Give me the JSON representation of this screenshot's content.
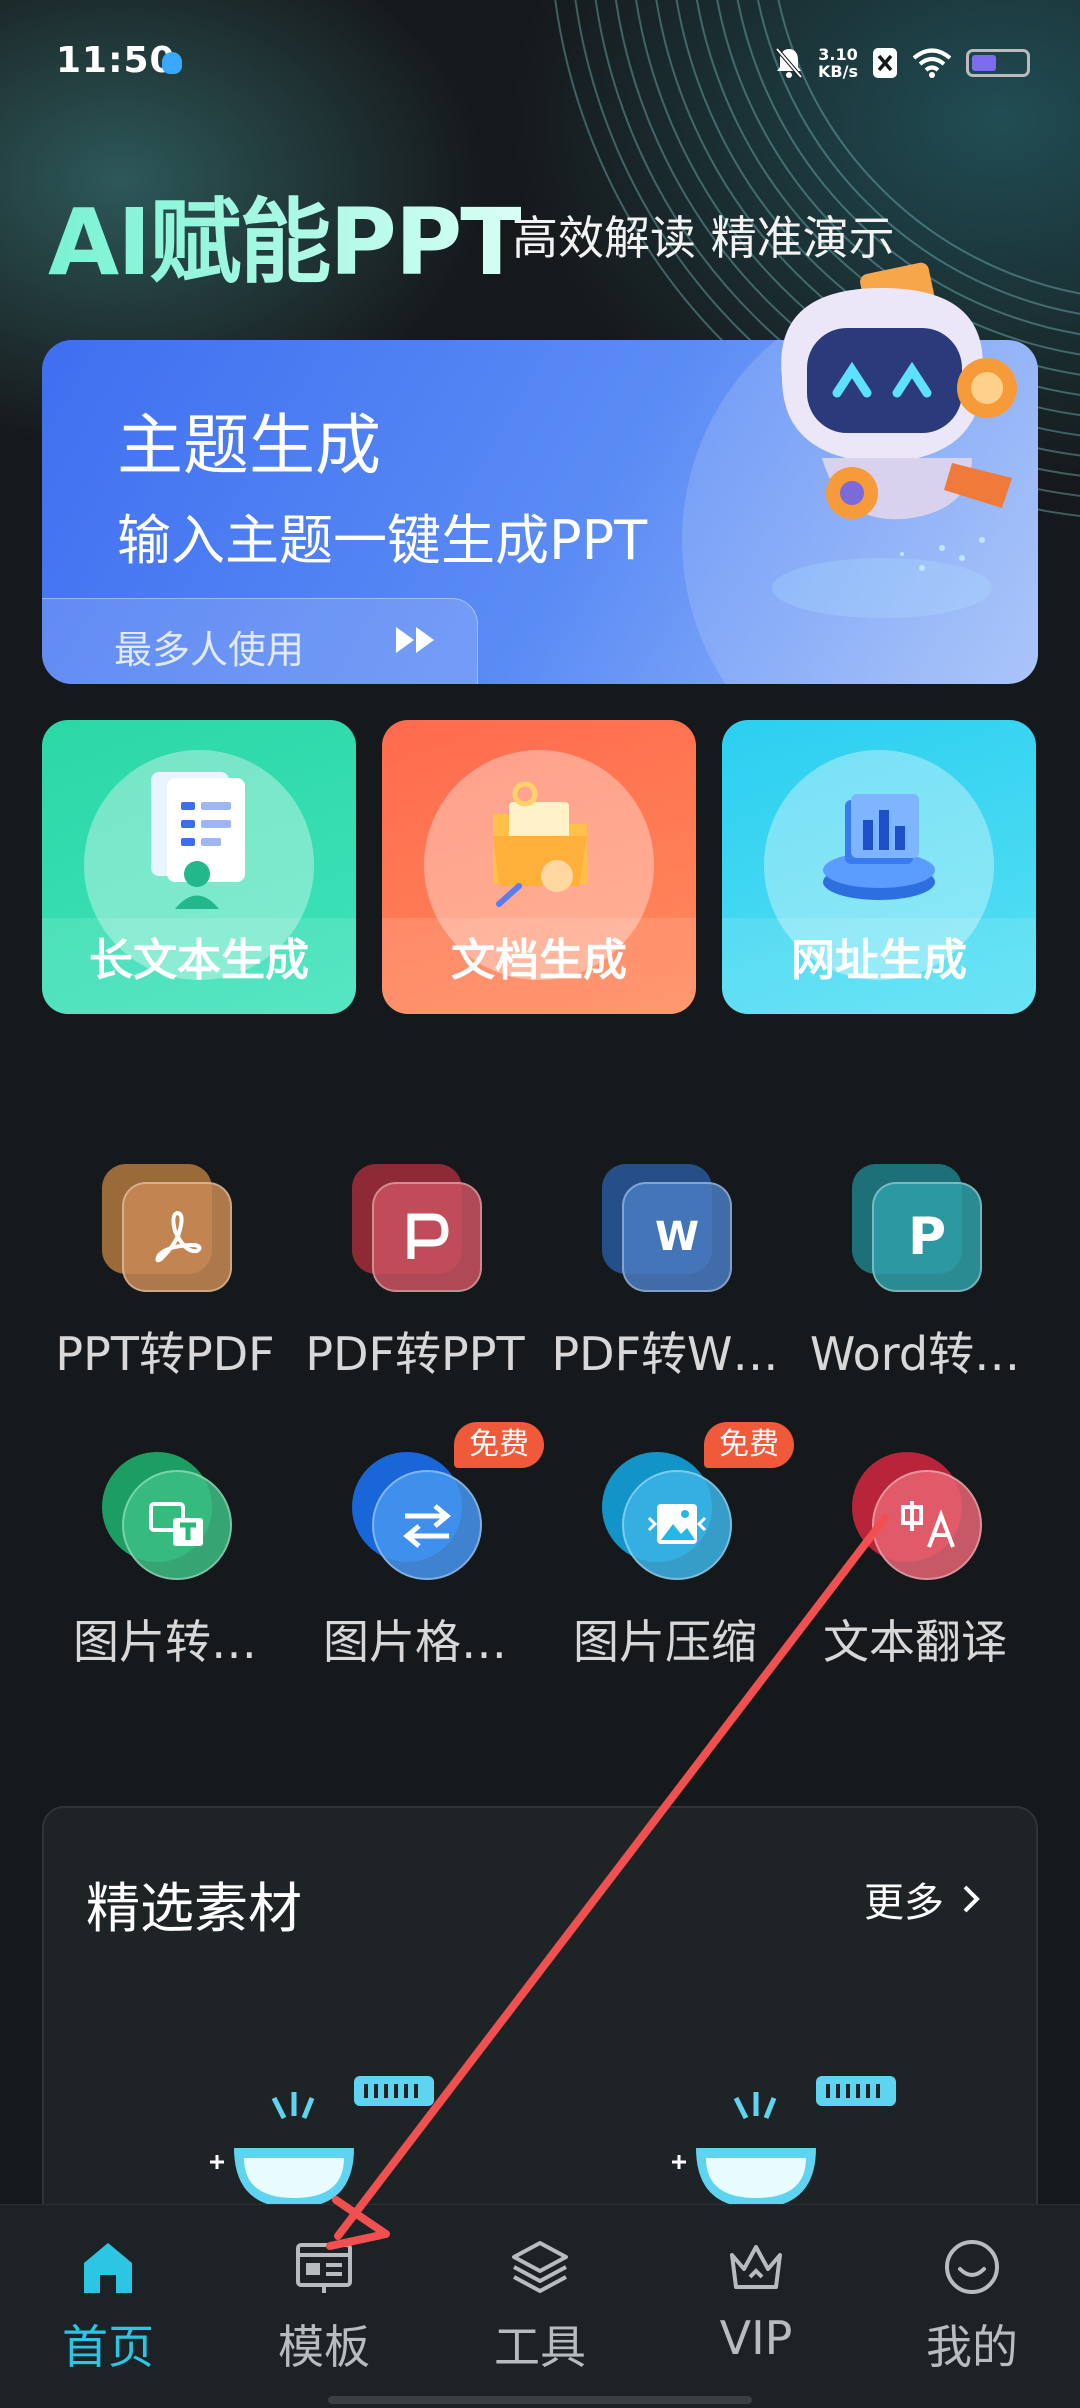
{
  "status_bar": {
    "time": "11:50",
    "speed_value": "3.10",
    "speed_unit": "KB/s"
  },
  "hero": {
    "title": "AI赋能PPT",
    "subtitle": "高效解读 精准演示"
  },
  "topic_card": {
    "title": "主题生成",
    "description": "输入主题一键生成PPT",
    "tag": "最多人使用"
  },
  "generate_cards": [
    {
      "label": "长文本生成",
      "color": "#2cd7a6"
    },
    {
      "label": "文档生成",
      "color": "#ff6a4d"
    },
    {
      "label": "网址生成",
      "color": "#2ccff0"
    }
  ],
  "tools": [
    {
      "label": "PPT转PDF",
      "icon": "pdf-icon",
      "color": "#c98a56"
    },
    {
      "label": "PDF转PPT",
      "icon": "ppt-icon",
      "color": "#c9525f",
      "glyph": "P"
    },
    {
      "label": "PDF转W…",
      "icon": "word-icon",
      "color": "#4a7bc0",
      "glyph": "W"
    },
    {
      "label": "Word转…",
      "icon": "ppt-p-icon",
      "color": "#2fa0a8",
      "glyph": "P"
    },
    {
      "label": "图片转…",
      "icon": "image-to-text-icon",
      "color": "#27b87a"
    },
    {
      "label": "图片格…",
      "icon": "format-convert-icon",
      "color": "#2f86f0",
      "badge": "免费"
    },
    {
      "label": "图片压缩",
      "icon": "image-compress-icon",
      "color": "#24b8e8",
      "badge": "免费"
    },
    {
      "label": "文本翻译",
      "icon": "translate-icon",
      "color": "#e0485a"
    }
  ],
  "materials": {
    "title": "精选素材",
    "more": "更多"
  },
  "bottom_nav": [
    {
      "label": "首页",
      "icon": "home-icon",
      "active": true
    },
    {
      "label": "模板",
      "icon": "template-icon",
      "active": false
    },
    {
      "label": "工具",
      "icon": "layers-icon",
      "active": false
    },
    {
      "label": "VIP",
      "icon": "crown-icon",
      "active": false
    },
    {
      "label": "我的",
      "icon": "profile-icon",
      "active": false
    }
  ],
  "colors": {
    "accent": "#2cc6e4",
    "background": "#16191b",
    "annotation": "#f0504f"
  }
}
